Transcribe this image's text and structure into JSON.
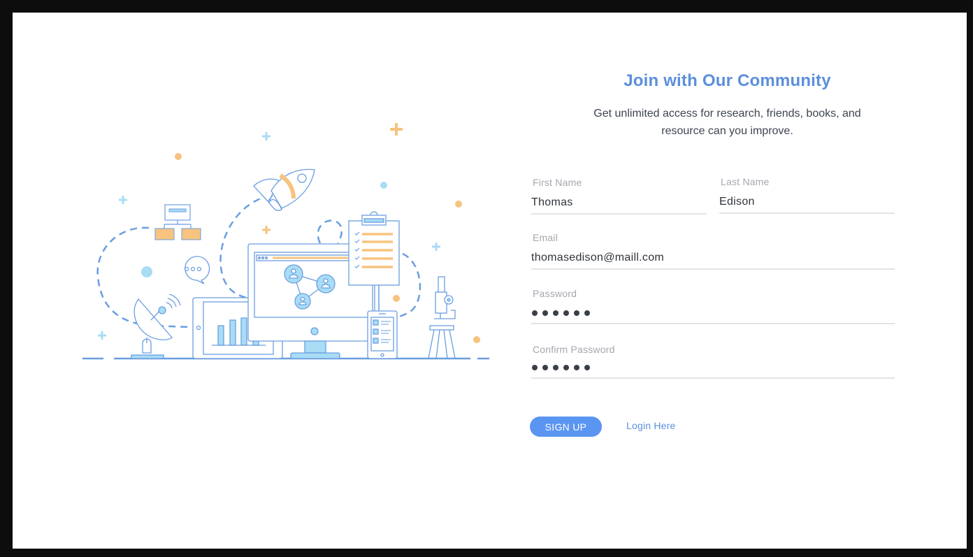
{
  "heading": {
    "title": "Join with Our Community",
    "subtitle": "Get unlimited access for research, friends, books, and resource can you improve."
  },
  "form": {
    "first_name": {
      "label": "First Name",
      "value": "Thomas"
    },
    "last_name": {
      "label": "Last Name",
      "value": "Edison"
    },
    "email": {
      "label": "Email",
      "value": "thomasedison@maill.com"
    },
    "password": {
      "label": "Password",
      "masked_length": 6
    },
    "confirm_password": {
      "label": "Confirm Password",
      "masked_length": 6
    }
  },
  "actions": {
    "signup_label": "SIGN UP",
    "login_label": "Login Here"
  },
  "colors": {
    "accent": "#5b8fdc",
    "button": "#5b95f2",
    "illustration_blue": "#6a9ee0",
    "illustration_light_blue": "#a9dcf5",
    "illustration_orange": "#f7c37f"
  },
  "illustration": {
    "icons": [
      "satellite-dish-icon",
      "rocket-icon",
      "monitor-icon",
      "tablet-chart-icon",
      "phone-icon",
      "clipboard-checklist-icon",
      "microscope-icon",
      "org-chart-icon",
      "chat-bubble-icon",
      "network-users-icon"
    ]
  }
}
